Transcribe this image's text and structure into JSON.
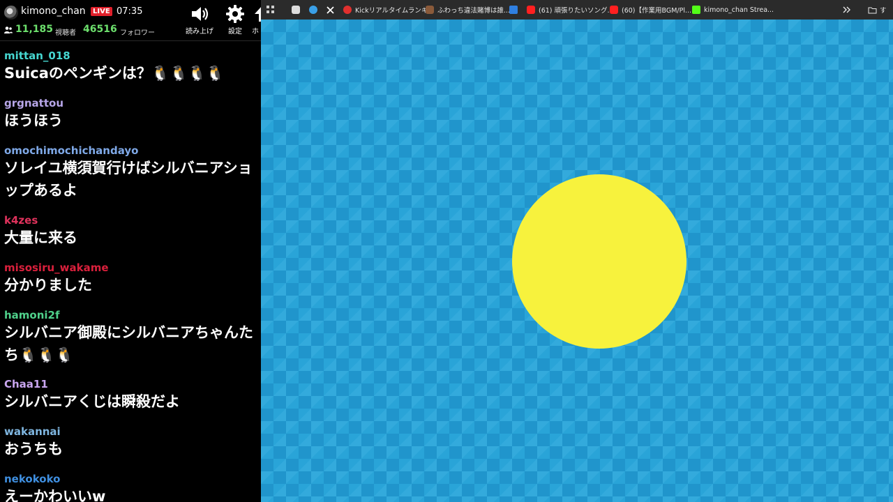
{
  "chat": {
    "header": {
      "channel_name": "kimono_chan",
      "live_badge": "LIVE",
      "elapsed_time": "07:35",
      "viewer_count": "11,185",
      "viewer_label": "視聴者",
      "follower_count": "46516",
      "follower_label": "フォロワー",
      "buttons": [
        {
          "label": "読み上げ",
          "icon": "speaker-icon"
        },
        {
          "label": "設定",
          "icon": "gear-icon"
        },
        {
          "label": "ホ",
          "icon": "arrow-up-icon"
        }
      ]
    },
    "messages": [
      {
        "user": "mittan_018",
        "user_color": "#46d7d1",
        "text": "Suicaのペンギンは？🐧🐧🐧🐧"
      },
      {
        "user": "grgnattou",
        "user_color": "#b7a6e8",
        "text": "ほうほう"
      },
      {
        "user": "omochimochichandayo",
        "user_color": "#7fa9e8",
        "text": "ソレイユ横須賀行けばシルバニアショップあるよ"
      },
      {
        "user": "k4zes",
        "user_color": "#e0325c",
        "text": "大量に来る"
      },
      {
        "user": "misosiru_wakame",
        "user_color": "#d9203c",
        "text": "分かりました"
      },
      {
        "user": "hamoni2f",
        "user_color": "#4fd18b",
        "text": "シルバニア御殿にシルバニアちゃんたち🐧🐧🐧"
      },
      {
        "user": "Chaa11",
        "user_color": "#c9a6f0",
        "text": "シルバニアくじは瞬殺だよ"
      },
      {
        "user": "wakannai",
        "user_color": "#7fb6e0",
        "text": "おうちも"
      },
      {
        "user": "nekokoko",
        "user_color": "#3f8fe0",
        "text": "えーかわいいw"
      }
    ]
  },
  "browser": {
    "bookmarks": [
      {
        "label": "",
        "icon": "apps-grid-icon",
        "color": "#cfcfcf"
      },
      {
        "label": "",
        "icon": "site-icon",
        "color": "#dddddd"
      },
      {
        "label": "",
        "icon": "site-icon",
        "color": "#3aa0e8"
      },
      {
        "label": "",
        "icon": "x-logo-icon",
        "color": "#ffffff"
      },
      {
        "label": "Kickリアルタイムランキ...",
        "icon": "kick-ranking-icon",
        "color": "#e0302e"
      },
      {
        "label": "ふわっち違法賭博は誰...",
        "icon": "avatar-icon",
        "color": "#8a5a3a"
      },
      {
        "label": "",
        "icon": "trello-icon",
        "color": "#2f7fe0"
      },
      {
        "label": "(61) 頑張りたいソング...",
        "icon": "youtube-icon",
        "color": "#ff2020"
      },
      {
        "label": "(60)【作業用BGM/Pl...",
        "icon": "youtube-icon",
        "color": "#ff2020"
      },
      {
        "label": "kimono_chan Strea...",
        "icon": "kick-icon",
        "color": "#53fc18"
      }
    ],
    "overflow_icon": "chevron-double-right-icon",
    "folder_label": "す",
    "stream": {
      "background_color": "#29a4d8",
      "circle_color": "#f7f23d"
    }
  }
}
